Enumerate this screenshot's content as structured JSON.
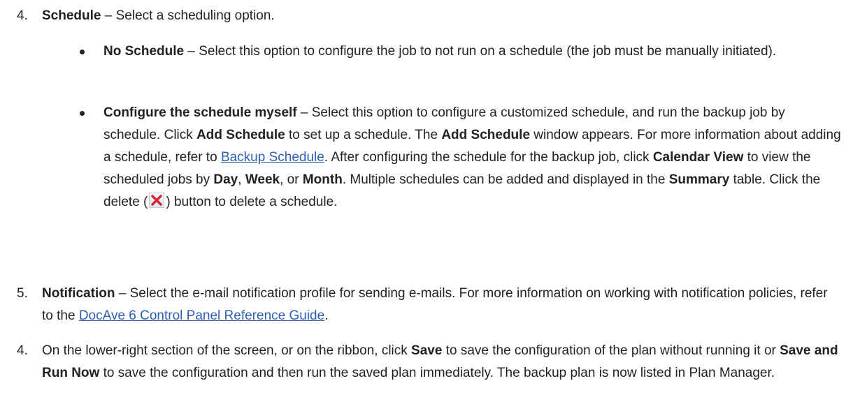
{
  "step4a": {
    "number": "4.",
    "label": "Schedule",
    "text": " – Select a scheduling option."
  },
  "no_schedule": {
    "label": "No Schedule",
    "text": " – Select this option to configure the job to not run on a schedule (the job must be manually initiated)."
  },
  "configure": {
    "label": "Configure the schedule myself",
    "t1": " – Select this option to configure a customized schedule, and run the backup job by schedule. Click ",
    "b1": "Add Schedule",
    "t2": " to set up a schedule. The ",
    "b2": "Add Schedule",
    "t3": " window appears. For more information about adding a schedule, refer to ",
    "link": "Backup Schedule",
    "t4": ". After configuring the schedule for the backup job, click ",
    "b3": "Calendar View",
    "t5": " to view the scheduled jobs by ",
    "b4": "Day",
    "t6": ", ",
    "b5": "Week",
    "t7": ", or ",
    "b6": "Month",
    "t8": ". Multiple schedules can be added and displayed in the ",
    "b7": "Summary",
    "t9": " table. Click the delete (",
    "t10": ") button to delete a schedule."
  },
  "step5": {
    "number": "5.",
    "label": "Notification",
    "t1": " – Select the e-mail notification profile for sending e-mails. For more information on working with notification policies, refer to the ",
    "link": "DocAve 6 Control Panel Reference Guide",
    "t2": "."
  },
  "step4b": {
    "number": "4.",
    "t1": "On the lower-right section of the screen, or on the ribbon, click ",
    "b1": "Save",
    "t2": " to save the configuration of the plan without running it or ",
    "b2": "Save and Run Now",
    "t3": " to save the configuration and then run the saved plan immediately. The backup plan is now listed in Plan Manager."
  },
  "icons": {
    "delete": "delete-x-icon"
  },
  "colors": {
    "link": "#2f5fb3",
    "delete_icon": "#d9262c"
  }
}
